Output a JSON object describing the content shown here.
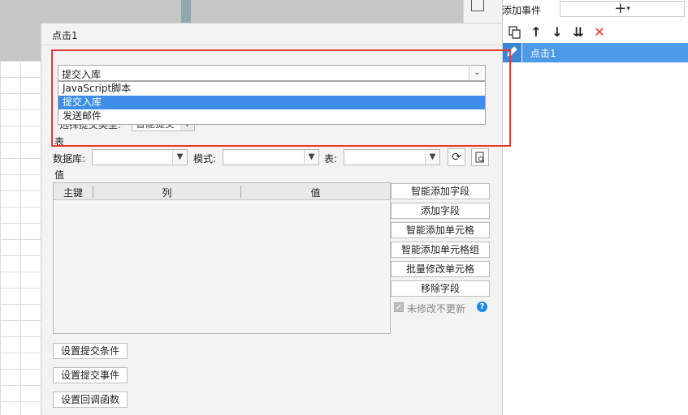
{
  "dialog": {
    "title": "点击1",
    "action_select": {
      "value": "提交入库",
      "options": [
        "JavaScript脚本",
        "提交入库",
        "发送邮件"
      ],
      "selected_index": 1
    },
    "submit_type": {
      "label": "选择提交类型:",
      "value": "智能提交"
    },
    "table_section_label": "表",
    "database_label": "数据库:",
    "mode_label": "模式:",
    "table_label": "表:",
    "database_value": "",
    "mode_value": "",
    "table_value": "",
    "value_section_label": "值",
    "columns": [
      "主键",
      "列",
      "值"
    ],
    "side_buttons": [
      "智能添加字段",
      "添加字段",
      "智能添加单元格",
      "智能添加单元格组",
      "批量修改单元格",
      "移除字段"
    ],
    "no_update_checkbox": {
      "label": "未修改不更新",
      "checked": true
    },
    "bottom_buttons": [
      "设置提交条件",
      "设置提交事件",
      "设置回调函数"
    ]
  },
  "right_panel": {
    "title": "添加事件",
    "add_button": "+",
    "toolbar": [
      "copy-icon",
      "arrow-up-icon",
      "arrow-down-icon",
      "move-bottom-icon",
      "delete-icon"
    ],
    "events": [
      {
        "label": "点击1",
        "selected": true
      }
    ]
  },
  "colors": {
    "selection_blue": "#3e8ee8",
    "highlight_red": "#e53935",
    "delete_red": "#e53935",
    "help_blue": "#1e88e5"
  }
}
